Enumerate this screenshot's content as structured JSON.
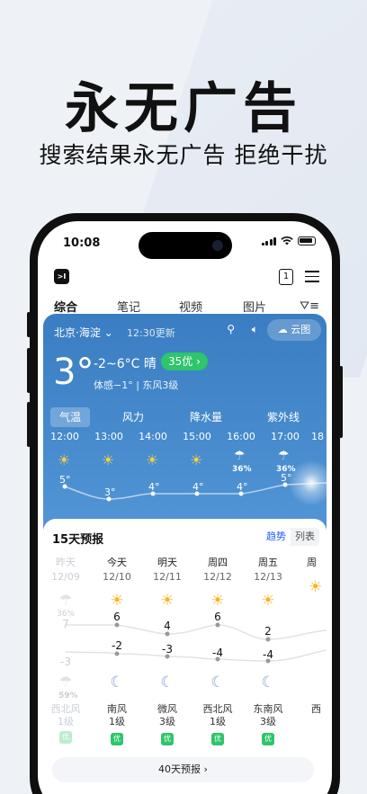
{
  "promo": {
    "headline": "永无广告",
    "subline": "搜索结果永无广告 拒绝干扰"
  },
  "status": {
    "time": "10:08"
  },
  "appbar": {
    "logo_text": ">I",
    "tab_count": "1"
  },
  "tabs": [
    {
      "label": "综合",
      "active": true
    },
    {
      "label": "笔记"
    },
    {
      "label": "视频"
    },
    {
      "label": "图片"
    }
  ],
  "weather": {
    "location": "北京·海淀",
    "updated": "12:30更新",
    "cloud_button": "云图",
    "current_temp": "3°",
    "range_cond": "-2~6°C 晴",
    "aqi": "35优",
    "feels": "体感−1° | 东风3级",
    "metrics": [
      "气温",
      "风力",
      "降水量",
      "紫外线"
    ],
    "hourly": [
      {
        "time": "12:00",
        "temp": "5°"
      },
      {
        "time": "13:00",
        "temp": "3°"
      },
      {
        "time": "14:00",
        "temp": "4°"
      },
      {
        "time": "15:00",
        "temp": "4°"
      },
      {
        "time": "16:00",
        "temp": "4°",
        "pop": "36%"
      },
      {
        "time": "17:00",
        "temp": "5°",
        "pop": "36%"
      },
      {
        "time": "18",
        "temp": ""
      }
    ]
  },
  "forecast": {
    "title": "15天预报",
    "seg_on": "趋势",
    "seg_off": "列表",
    "days": [
      {
        "name": "昨天",
        "date": "12/09",
        "pop": "36%",
        "hi": "7",
        "lo": "-3",
        "night_pop": "59%",
        "wind1": "西北风",
        "wind2": "1级",
        "aqi": "优",
        "past": true
      },
      {
        "name": "今天",
        "date": "12/10",
        "hi": "6",
        "lo": "-2",
        "wind1": "南风",
        "wind2": "1级",
        "aqi": "优"
      },
      {
        "name": "明天",
        "date": "12/11",
        "hi": "4",
        "lo": "-3",
        "wind1": "微风",
        "wind2": "3级",
        "aqi": "优"
      },
      {
        "name": "周四",
        "date": "12/12",
        "hi": "6",
        "lo": "-4",
        "wind1": "西北风",
        "wind2": "1级",
        "aqi": "优"
      },
      {
        "name": "周五",
        "date": "12/13",
        "hi": "2",
        "lo": "-4",
        "wind1": "东南风",
        "wind2": "3级",
        "aqi": "优"
      },
      {
        "name": "周",
        "date": "",
        "hi": "",
        "lo": "",
        "wind1": "西",
        "wind2": "",
        "aqi": ""
      }
    ],
    "forty_button": "40天预报 ›"
  }
}
